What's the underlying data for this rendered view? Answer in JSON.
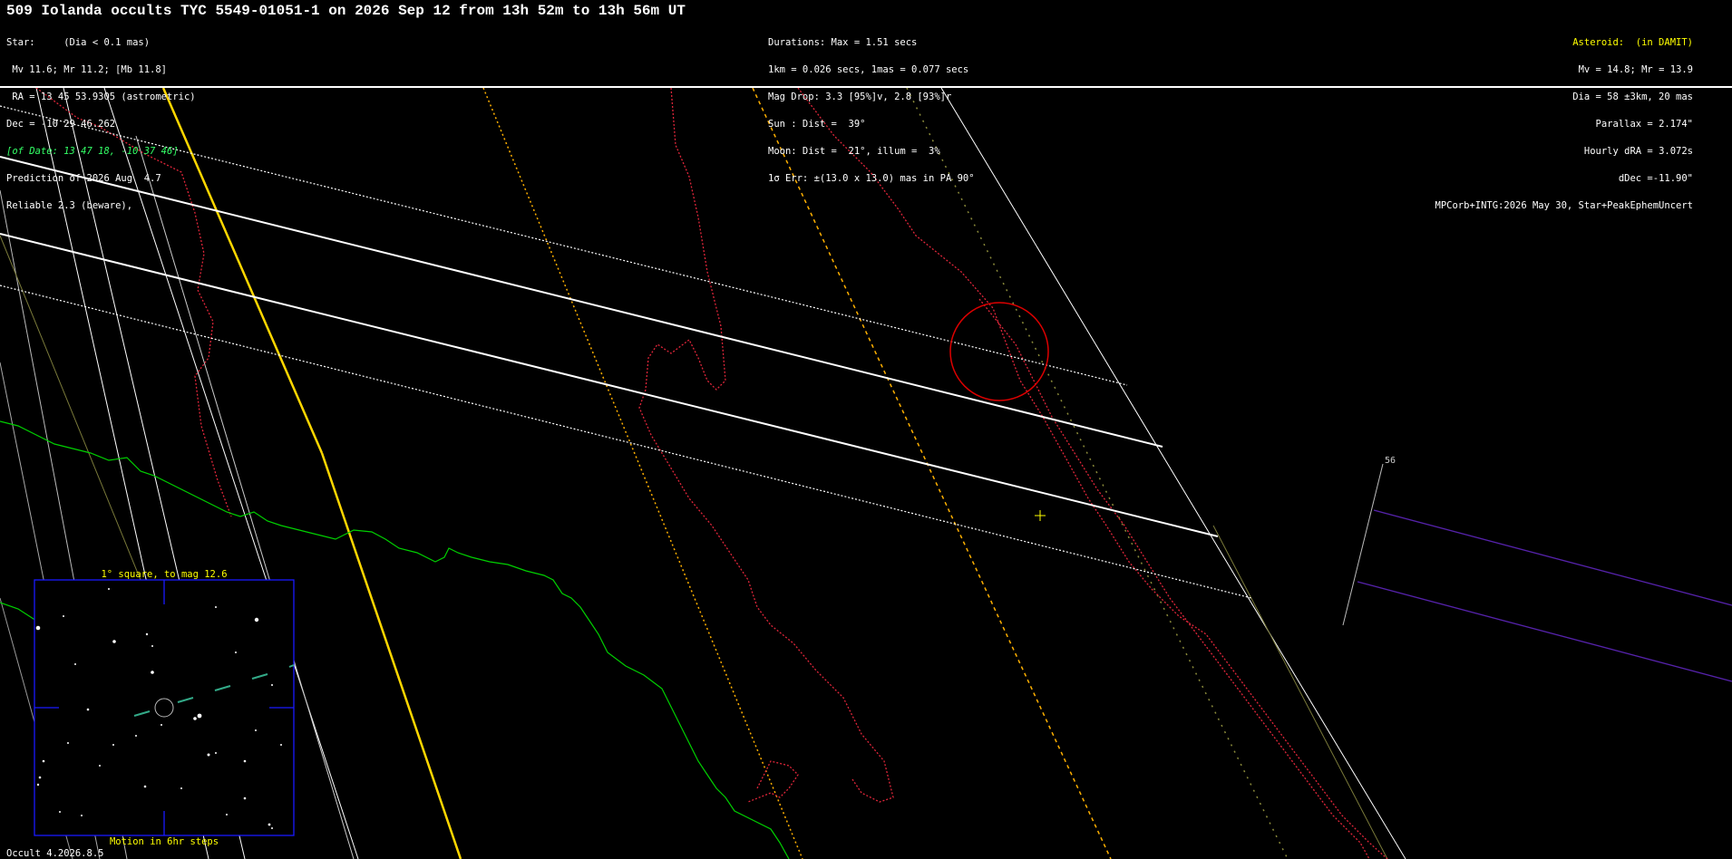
{
  "title": "509 Iolanda occults TYC 5549-01051-1 on 2026 Sep 12 from 13h 52m to 13h 56m UT",
  "star_info": {
    "line1": "Star:     (Dia < 0.1 mas)",
    "line2": " Mv 11.6; Mr 11.2; [Mb 11.8]",
    "line3": " RA = 13 45 53.9305 (astrometric)",
    "line4": "Dec = -10 29 46.262",
    "line5": "[of Date: 13 47 18, -10 37 46]",
    "line6": "Prediction of 2026 Aug  4.7",
    "line7": "Reliable 2.3 (beware),"
  },
  "event_info": {
    "line1": "Durations: Max = 1.51 secs",
    "line2": "1km = 0.026 secs, 1mas = 0.077 secs",
    "line3": "Mag Drop: 3.3 [95%]v, 2.8 [93%]r",
    "line4": "Sun : Dist =  39°",
    "line5": "Moon: Dist =  21°, illum =  3%",
    "line6": "1σ Err: ±(13.0 x 13.0) mas in PA 90°"
  },
  "asteroid_info": {
    "line1": "Asteroid:  (in DAMIT)",
    "line2": "Mv = 14.8; Mr = 13.9",
    "line3": "Dia = 58 ±3km, 20 mas",
    "line4": "Parallax = 2.174\"",
    "line5": "Hourly dRA = 3.072s",
    "line6": "dDec =-11.90\"",
    "line7": "MPCorb+INTG:2026 May 30, Star+PeakEphemUncert"
  },
  "inset": {
    "caption_top": "1° square, to mag 12.6",
    "caption_bottom": "Motion in 6hr steps"
  },
  "time_marker": "56",
  "footer": "Occult 4.2026.8.5",
  "colors": {
    "background": "#000000",
    "path_lines": "#ffffff",
    "centre_line": "#ffd700",
    "border_dotted": "#e0263a",
    "coastline": "#00d000",
    "inset_frame": "#1a1aff",
    "star_circle": "#dd0000",
    "purple_track": "#5522aa",
    "label_yellow": "#ffff00"
  }
}
